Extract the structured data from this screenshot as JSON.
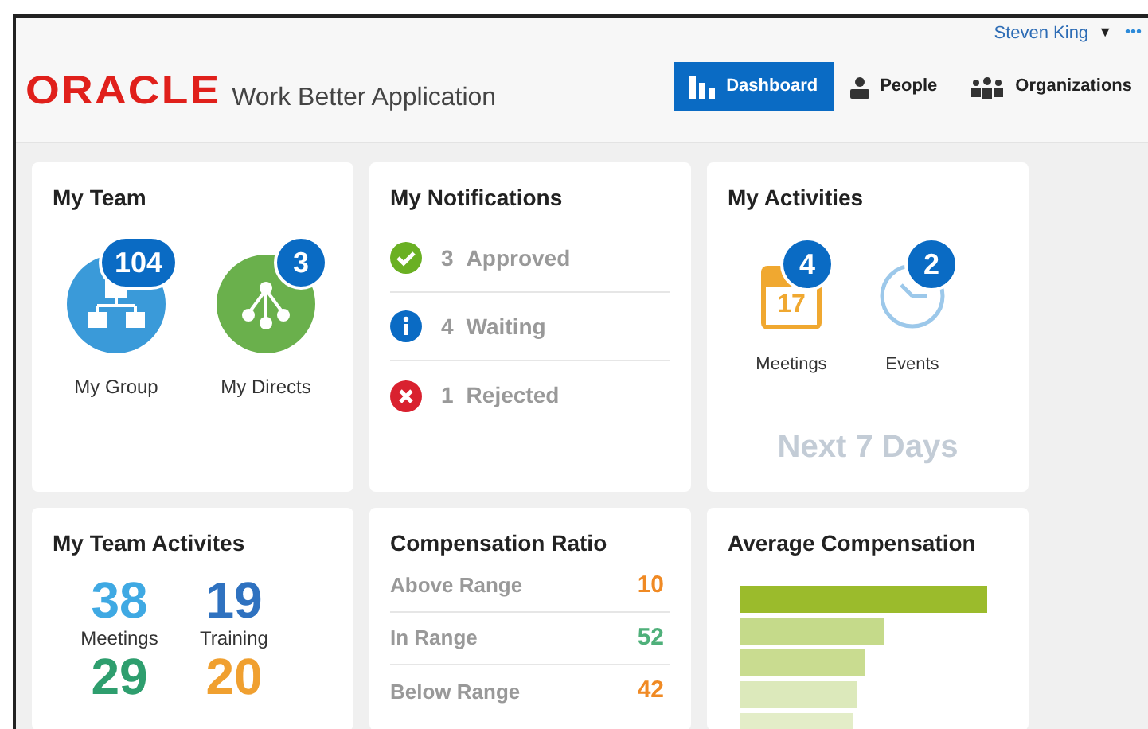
{
  "header": {
    "logo": "ORACLE",
    "app_title": "Work Better Application",
    "user": {
      "name": "Steven King",
      "caret": "▼",
      "more": "•••"
    },
    "nav": [
      {
        "label": "Dashboard",
        "selected": true
      },
      {
        "label": "People",
        "selected": false
      },
      {
        "label": "Organizations",
        "selected": false
      }
    ]
  },
  "my_team": {
    "title": "My Team",
    "items": [
      {
        "kind": "group",
        "count": "104",
        "label": "My Group"
      },
      {
        "kind": "directs",
        "count": "3",
        "label": "My Directs"
      }
    ]
  },
  "my_notifications": {
    "title": "My Notifications",
    "items": [
      {
        "kind": "approved",
        "count": "3",
        "label": "Approved"
      },
      {
        "kind": "info",
        "count": "4",
        "label": "Waiting"
      },
      {
        "kind": "rejected",
        "count": "1",
        "label": "Rejected"
      }
    ]
  },
  "my_activities": {
    "title": "My Activities",
    "items": [
      {
        "kind": "calendar",
        "count": "4",
        "label": "Meetings",
        "day": "17"
      },
      {
        "kind": "clock",
        "count": "2",
        "label": "Events"
      }
    ],
    "footer": "Next 7 Days"
  },
  "my_team_activities": {
    "title": "My Team Activites",
    "stats": [
      {
        "value": "38",
        "label": "Meetings",
        "color": "#3fa9e3"
      },
      {
        "value": "19",
        "label": "Training",
        "color": "#2f72c0"
      },
      {
        "value": "29",
        "color": "#2e9e6e"
      },
      {
        "value": "20",
        "color": "#f0a030"
      }
    ]
  },
  "compensation_ratio": {
    "title": "Compensation Ratio",
    "rows": [
      {
        "label": "Above Range",
        "value": "10",
        "color": "#f08a24"
      },
      {
        "label": "In Range",
        "value": "52",
        "color": "#4fb07a"
      },
      {
        "label": "Below Range",
        "value": "42",
        "color": "#f08a24"
      }
    ]
  },
  "average_compensation": {
    "title": "Average Compensation"
  }
}
